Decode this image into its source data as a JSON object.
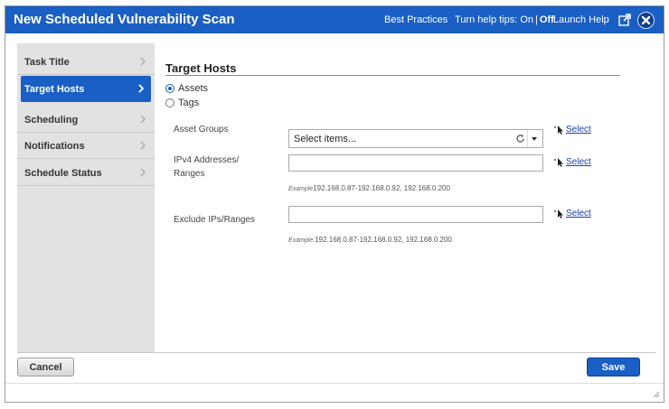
{
  "dialog": {
    "title": "New Scheduled Vulnerability Scan",
    "best_practices": "Best Practices",
    "help_tips_prefix": "Turn help tips:",
    "help_tips_on": "On",
    "help_tips_sep": "|",
    "help_tips_off": "Off",
    "launch_help": "Launch Help"
  },
  "sidebar": {
    "items": [
      {
        "label": "Task Title"
      },
      {
        "label": "Target Hosts",
        "active": true
      },
      {
        "label": "Scheduling"
      },
      {
        "label": "Notifications"
      },
      {
        "label": "Schedule Status"
      }
    ]
  },
  "main": {
    "section_title": "Target Hosts",
    "target_options": [
      {
        "label": "Assets",
        "checked": true
      },
      {
        "label": "Tags",
        "checked": false
      }
    ],
    "asset_groups": {
      "label": "Asset Groups",
      "placeholder": "Select items...",
      "select_link": "Select"
    },
    "ipv4": {
      "label_line1": "IPv4 Addresses/",
      "label_line2": "Ranges",
      "value": "",
      "select_link": "Select",
      "example_label": "Example",
      "example_value": "192.168.0.87-192.168.0.92, 192.168.0.200"
    },
    "exclude": {
      "label": "Exclude IPs/Ranges",
      "value": "",
      "select_link": "Select",
      "example_label": "Example:",
      "example_value": "192.168.0.87-192.168.0.92, 192.168.0.200"
    }
  },
  "footer": {
    "cancel_label": "Cancel",
    "save_label": "Save"
  },
  "colors": {
    "brand_blue": "#1a5fc4",
    "sidebar_bg": "#e2e2e2",
    "link_blue": "#1a3fb0"
  }
}
